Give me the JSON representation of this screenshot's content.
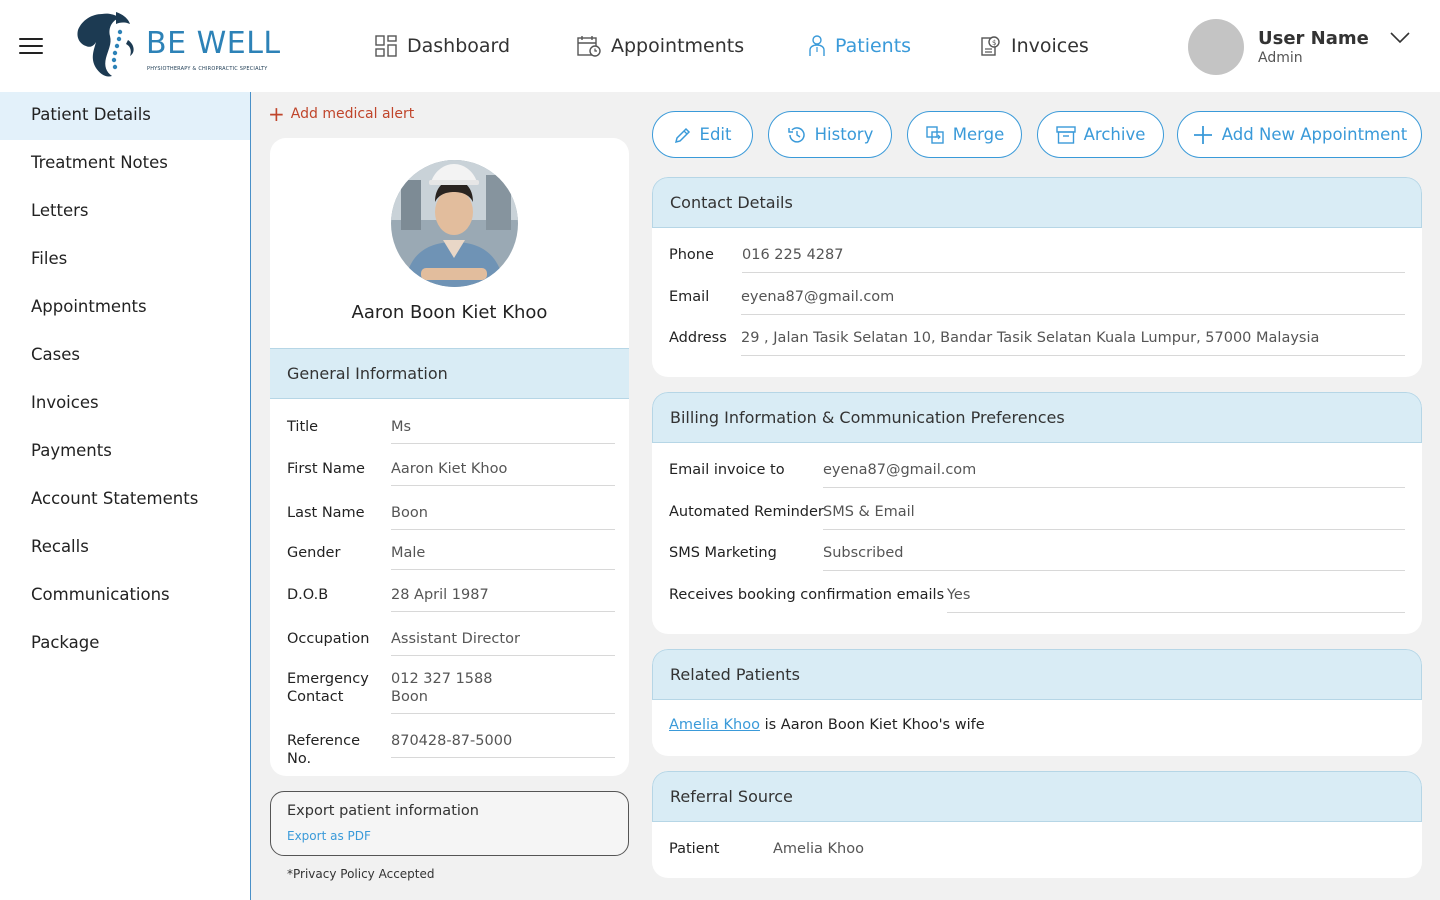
{
  "brand": {
    "name": "BE WELL",
    "tagline": "PHYSIOTHERAPY & CHIROPRACTIC SPECIALTY"
  },
  "nav": {
    "dashboard": "Dashboard",
    "appointments": "Appointments",
    "patients": "Patients",
    "invoices": "Invoices",
    "active": "patients"
  },
  "user": {
    "name": "User Name",
    "role": "Admin"
  },
  "sidebar": {
    "items": [
      "Patient Details",
      "Treatment Notes",
      "Letters",
      "Files",
      "Appointments",
      "Cases",
      "Invoices",
      "Payments",
      "Account Statements",
      "Recalls",
      "Communications",
      "Package"
    ],
    "active_index": 0
  },
  "alert": {
    "add_label": "Add medical alert"
  },
  "patient": {
    "full_name": "Aaron Boon Kiet Khoo",
    "general_heading": "General Information",
    "fields": [
      {
        "label": "Title",
        "value": "Ms"
      },
      {
        "label": "First Name",
        "value": "Aaron Kiet Khoo"
      },
      {
        "label": "Last Name",
        "value": "Boon"
      },
      {
        "label": "Gender",
        "value": "Male"
      },
      {
        "label": "D.O.B",
        "value": "28 April 1987"
      },
      {
        "label": "Occupation",
        "value": "Assistant Director"
      },
      {
        "label_line1": "Emergency",
        "label_line2": "Contact",
        "value_line1": "012 327 1588",
        "value_line2": "Boon"
      },
      {
        "label": "Reference No.",
        "value": "870428-87-5000"
      }
    ]
  },
  "export": {
    "title": "Export patient information",
    "link": "Export as PDF"
  },
  "privacy": "*Privacy Policy Accepted",
  "actions": {
    "edit": "Edit",
    "history": "History",
    "merge": "Merge",
    "archive": "Archive",
    "add_appointment": "Add New Appointment"
  },
  "contact": {
    "heading": "Contact Details",
    "phone_label": "Phone",
    "phone": "016 225 4287",
    "email_label": "Email",
    "email": "eyena87@gmail.com",
    "address_label": "Address",
    "address": "29 , Jalan Tasik Selatan 10, Bandar Tasik Selatan Kuala Lumpur, 57000 Malaysia"
  },
  "billing": {
    "heading": "Billing Information & Communication Preferences",
    "email_invoice_label": "Email invoice to",
    "email_invoice": "eyena87@gmail.com",
    "reminder_label": "Automated Reminder",
    "reminder": "SMS & Email",
    "sms_label": "SMS Marketing",
    "sms": "Subscribed",
    "booking_label": "Receives booking confirmation emails",
    "booking": "Yes"
  },
  "related": {
    "heading": "Related Patients",
    "link_name": "Amelia Khoo",
    "middle_text": " is Aaron Boon Kiet Khoo's ",
    "relation": "wife"
  },
  "referral": {
    "heading": "Referral Source",
    "label": "Patient",
    "value": "Amelia Khoo"
  },
  "colors": {
    "accent": "#3a9ad9",
    "alert": "#c0452b",
    "section_header": "#d9ecf5",
    "sidebar_active": "#e3f1fa"
  }
}
